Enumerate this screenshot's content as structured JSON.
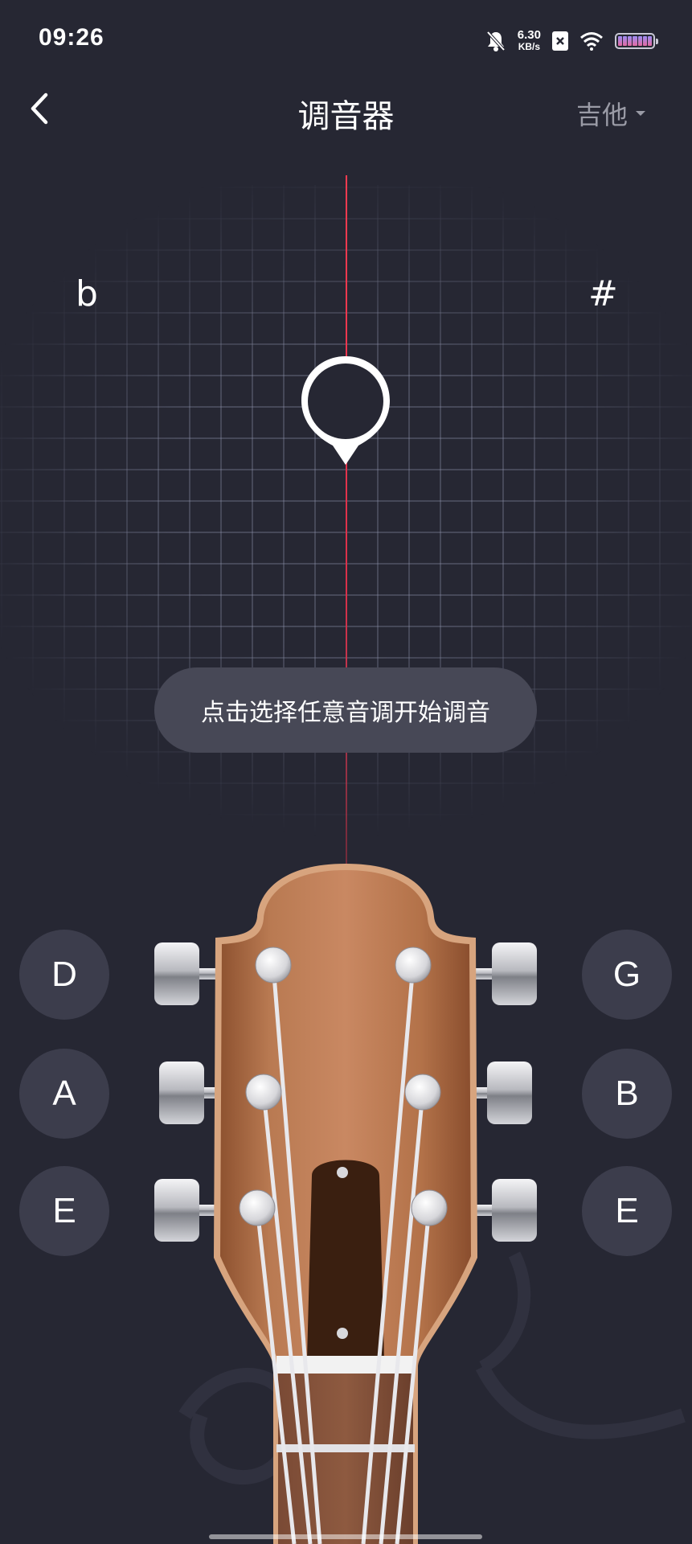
{
  "status_bar": {
    "time": "09:26",
    "net_speed_value": "6.30",
    "net_speed_unit": "KB/s",
    "icons": [
      "mute-bell-icon",
      "close-box-icon",
      "wifi-icon",
      "battery-icon"
    ]
  },
  "header": {
    "title": "调音器",
    "instrument": "吉他",
    "back_icon": "chevron-left-icon"
  },
  "tuner": {
    "flat_symbol": "b",
    "sharp_symbol": "#",
    "hint": "点击选择任意音调开始调音",
    "center_line_color": "#ff3b50"
  },
  "strings": {
    "left": [
      "D",
      "A",
      "E"
    ],
    "right": [
      "G",
      "B",
      "E"
    ]
  },
  "colors": {
    "background": "#262733",
    "button": "#3c3d4c",
    "toast": "#474856",
    "wood": "#b06e47"
  }
}
